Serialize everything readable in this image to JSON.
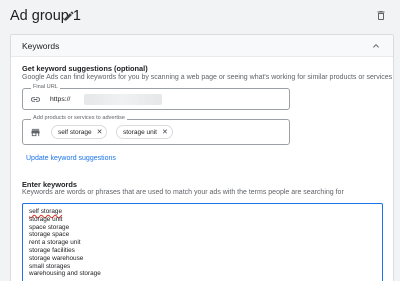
{
  "header": {
    "title": "Ad group 1",
    "edit_icon": "pencil-icon",
    "delete_icon": "trash-icon"
  },
  "card": {
    "title": "Keywords",
    "collapse_icon": "chevron-up-icon",
    "suggestions": {
      "title": "Get keyword suggestions (optional)",
      "description": "Google Ads can find keywords for you by scanning a web page or seeing what's working for similar products or services",
      "url_field": {
        "label": "Final URL",
        "icon": "link-icon",
        "value_prefix": "https://"
      },
      "products_field": {
        "label": "Add products or services to advertise",
        "icon": "storefront-icon",
        "chips": [
          "self storage",
          "storage unit"
        ]
      },
      "update_link": "Update keyword suggestions"
    },
    "enter_keywords": {
      "title": "Enter keywords",
      "description": "Keywords are words or phrases that are used to match your ads with the terms people are searching for",
      "keywords": [
        "self storage",
        "storage unit",
        "space storage",
        "storage space",
        "rent a storage unit",
        "storage facilities",
        "storage warehouse",
        "small storages",
        "warehousing and storage"
      ]
    }
  },
  "colors": {
    "accent": "#1a73e8",
    "background": "#f1f3f4",
    "spellcheck": "#d93025"
  }
}
